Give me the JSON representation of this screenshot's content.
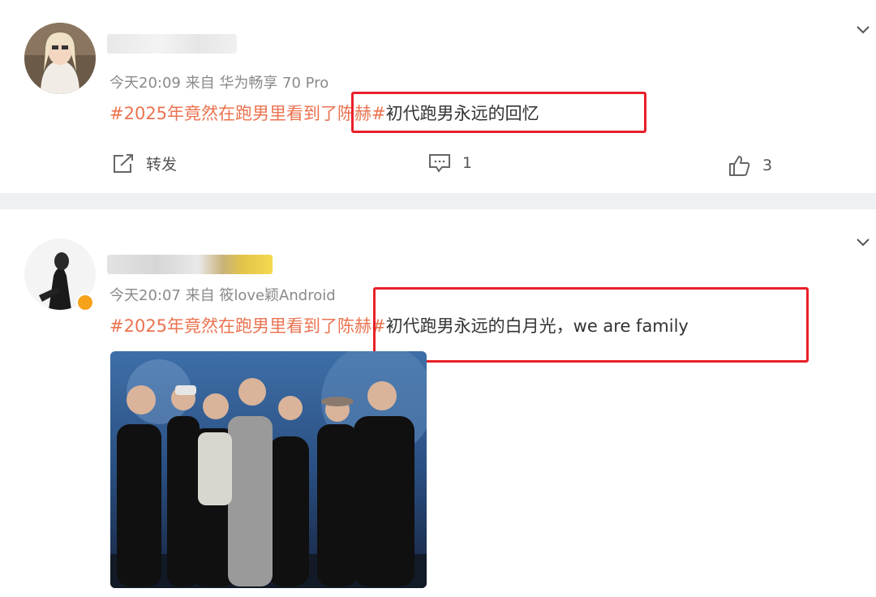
{
  "posts": [
    {
      "meta": "今天20:09  来自 华为畅享 70 Pro",
      "topic": "#2025年竟然在跑男里看到了陈赫#",
      "body": "初代跑男永远的回忆",
      "actions": {
        "repost_label": "转发",
        "comment_count": "1",
        "like_count": "3"
      }
    },
    {
      "meta": "今天20:07  来自 筱love颖Android",
      "topic": "#2025年竟然在跑男里看到了陈赫#",
      "body": "初代跑男永远的白月光，we are family"
    }
  ],
  "colors": {
    "topic": "#eb7350",
    "highlight": "#e8202a",
    "badge": "#f7a21b"
  },
  "icons": [
    "chevron-down-icon",
    "repost-icon",
    "comment-icon",
    "like-icon",
    "verified-badge-icon"
  ]
}
